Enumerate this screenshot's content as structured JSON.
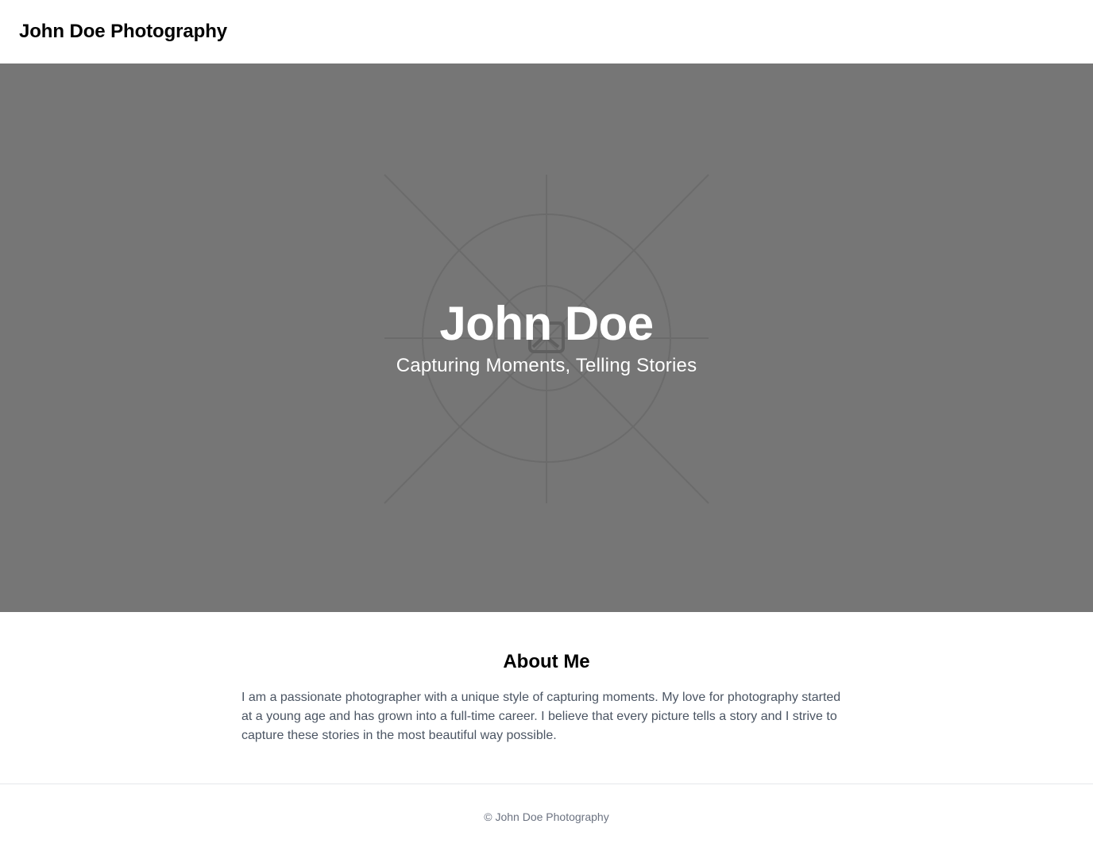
{
  "header": {
    "site_title": "John Doe Photography"
  },
  "hero": {
    "name": "John Doe",
    "tagline": "Capturing Moments, Telling Stories",
    "background_color": "#767676",
    "image_placeholder_icon": "image-placeholder-icon"
  },
  "about": {
    "heading": "About Me",
    "body": "I am a passionate photographer with a unique style of capturing moments. My love for photography started at a young age and has grown into a full-time career. I believe that every picture tells a story and I strive to capture these stories in the most beautiful way possible."
  },
  "footer": {
    "copyright": "© John Doe Photography"
  },
  "colors": {
    "hero_background": "#767676",
    "body_text": "#4b5563",
    "footer_text": "#6b7280",
    "heading_text": "#000000"
  }
}
